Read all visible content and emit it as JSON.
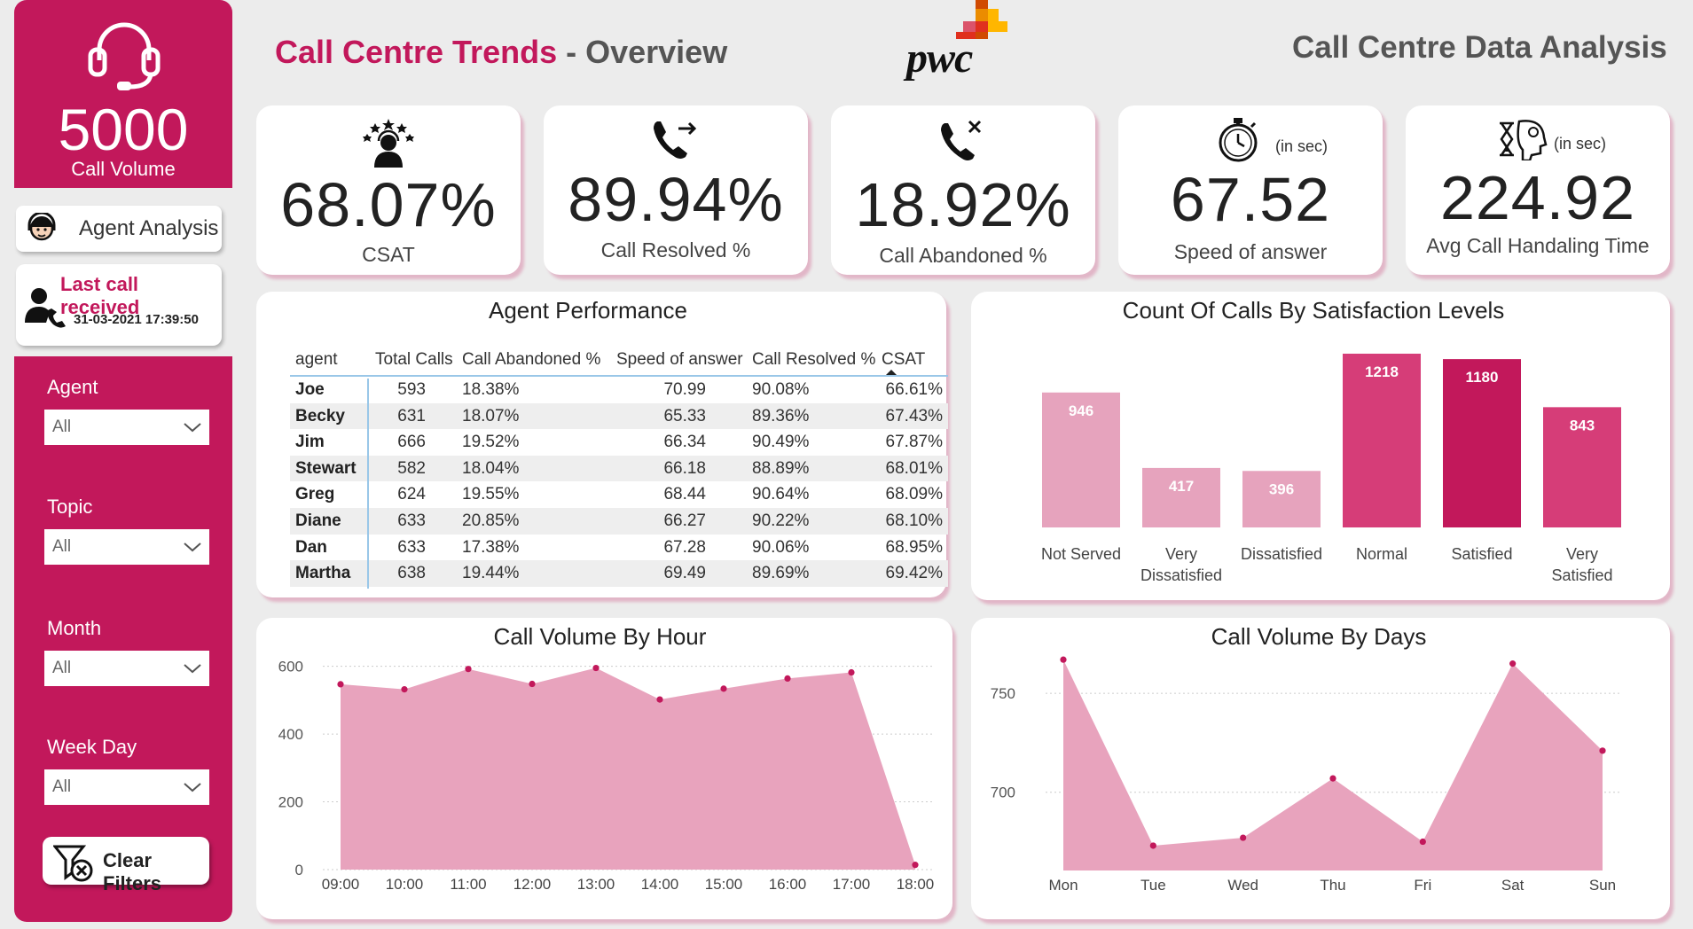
{
  "sidebar": {
    "call_volume_value": "5000",
    "call_volume_label": "Call Volume",
    "agent_analysis_label": "Agent Analysis",
    "last_call_title": "Last call received",
    "last_call_time": "31-03-2021 17:39:50",
    "filters": [
      {
        "label": "Agent",
        "value": "All"
      },
      {
        "label": "Topic",
        "value": "All"
      },
      {
        "label": "Month",
        "value": "All"
      },
      {
        "label": "Week Day",
        "value": "All"
      }
    ],
    "clear_filters_label": "Clear Filters"
  },
  "header": {
    "title_part1": "Call Centre Trends",
    "title_sep": " - ",
    "title_part2": "Overview",
    "logo_text": "pwc",
    "right_title": "Call Centre Data Analysis"
  },
  "kpis": [
    {
      "value": "68.07%",
      "label": "CSAT",
      "icon": "customer-satisfaction-icon",
      "unit_note": ""
    },
    {
      "value": "89.94%",
      "label": "Call Resolved %",
      "icon": "phone-forward-icon",
      "unit_note": ""
    },
    {
      "value": "18.92%",
      "label": "Call Abandoned %",
      "icon": "phone-missed-icon",
      "unit_note": ""
    },
    {
      "value": "67.52",
      "label": "Speed of answer",
      "icon": "stopwatch-icon",
      "unit_note": "(in sec)"
    },
    {
      "value": "224.92",
      "label": "Avg Call Handaling Time",
      "icon": "hourglass-head-icon",
      "unit_note": "(in sec)"
    }
  ],
  "agent_performance": {
    "title": "Agent Performance",
    "columns": [
      "agent",
      "Total Calls",
      "Call Abandoned %",
      "Speed of answer",
      "Call Resolved %",
      "CSAT"
    ],
    "rows": [
      [
        "Joe",
        "593",
        "18.38%",
        "70.99",
        "90.08%",
        "66.61%"
      ],
      [
        "Becky",
        "631",
        "18.07%",
        "65.33",
        "89.36%",
        "67.43%"
      ],
      [
        "Jim",
        "666",
        "19.52%",
        "66.34",
        "90.49%",
        "67.87%"
      ],
      [
        "Stewart",
        "582",
        "18.04%",
        "66.18",
        "88.89%",
        "68.01%"
      ],
      [
        "Greg",
        "624",
        "19.55%",
        "68.44",
        "90.64%",
        "68.09%"
      ],
      [
        "Diane",
        "633",
        "20.85%",
        "66.27",
        "90.22%",
        "68.10%"
      ],
      [
        "Dan",
        "633",
        "17.38%",
        "67.28",
        "90.06%",
        "68.95%"
      ],
      [
        "Martha",
        "638",
        "19.44%",
        "69.49",
        "89.69%",
        "69.42%"
      ]
    ]
  },
  "chart_data": [
    {
      "type": "bar",
      "title": "Count Of Calls By Satisfaction Levels",
      "categories": [
        "Not Served",
        "Very Dissatisfied",
        "Dissatisfied",
        "Normal",
        "Satisfied",
        "Very Satisfied"
      ],
      "category_lines": [
        [
          "Not Served"
        ],
        [
          "Very",
          "Dissatisfied"
        ],
        [
          "Dissatisfied"
        ],
        [
          "Normal"
        ],
        [
          "Satisfied"
        ],
        [
          "Very",
          "Satisfied"
        ]
      ],
      "values": [
        946,
        417,
        396,
        1218,
        1180,
        843
      ],
      "colors": [
        "#e6a3bd",
        "#e6a3bd",
        "#e6a3bd",
        "#d63d78",
        "#c2185b",
        "#d63d78"
      ],
      "data_labels": true
    },
    {
      "type": "area",
      "title": "Call Volume By Hour",
      "x": [
        "09:00",
        "10:00",
        "11:00",
        "12:00",
        "13:00",
        "14:00",
        "15:00",
        "16:00",
        "17:00",
        "18:00"
      ],
      "values": [
        547,
        532,
        592,
        548,
        595,
        502,
        534,
        564,
        582,
        14
      ],
      "yticks": [
        0,
        200,
        400,
        600
      ],
      "ylim": [
        0,
        620
      ],
      "fill": "#e8a3bd",
      "marker": "#c2185b"
    },
    {
      "type": "area",
      "title": "Call Volume By Days",
      "x": [
        "Mon",
        "Tue",
        "Wed",
        "Thu",
        "Fri",
        "Sat",
        "Sun"
      ],
      "values": [
        767,
        673,
        677,
        707,
        675,
        765,
        721
      ],
      "yticks": [
        700,
        750
      ],
      "ylim": [
        660,
        772
      ],
      "fill": "#e8a3bd",
      "marker": "#c2185b"
    }
  ]
}
